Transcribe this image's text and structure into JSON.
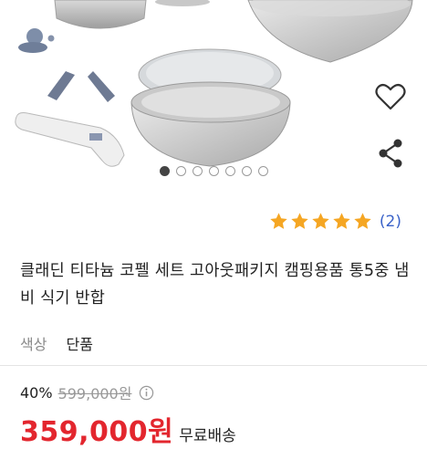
{
  "product": {
    "title": "클래딘 티타늄 코펠 세트 고아웃패키지 캠핑용품 통5중 냄비 식기 반합",
    "image_alt": "cookware set photo"
  },
  "gallery": {
    "dot_count": 7,
    "active_index": 0
  },
  "actions": {
    "like_icon": "heart-icon",
    "share_icon": "share-icon"
  },
  "rating": {
    "stars": 5,
    "max": 5,
    "review_count": "(2)"
  },
  "option": {
    "label": "색상",
    "value": "단품"
  },
  "price": {
    "discount": "40%",
    "original": "599,000원",
    "final": "359,000원",
    "shipping": "무료배송"
  },
  "colors": {
    "accent_red": "#e3262e",
    "star": "#f5a623",
    "link_blue": "#3b63c9"
  }
}
